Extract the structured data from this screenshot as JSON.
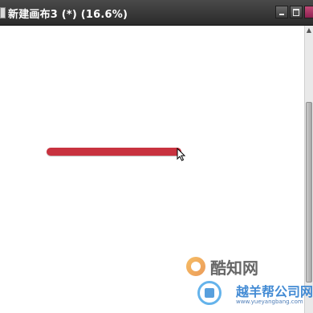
{
  "window": {
    "title": "新建画布3 (*) (16.6%)",
    "buttons": {
      "minimize": "minimize-icon",
      "maximize": "maximize-icon",
      "close": "close-icon"
    }
  },
  "canvas": {
    "background": "#ffffff",
    "stroke_color": "#c8323f"
  },
  "scrollbar": {
    "up_arrow": "▲"
  },
  "watermarks": {
    "site1_text": "酷知网",
    "site2_text": "越羊帮公司网",
    "site2_url": "www.yueyangbang.com"
  },
  "colors": {
    "titlebar": "#333333",
    "close_button": "#a8325e",
    "watermark_blue": "#2f7fd0"
  }
}
